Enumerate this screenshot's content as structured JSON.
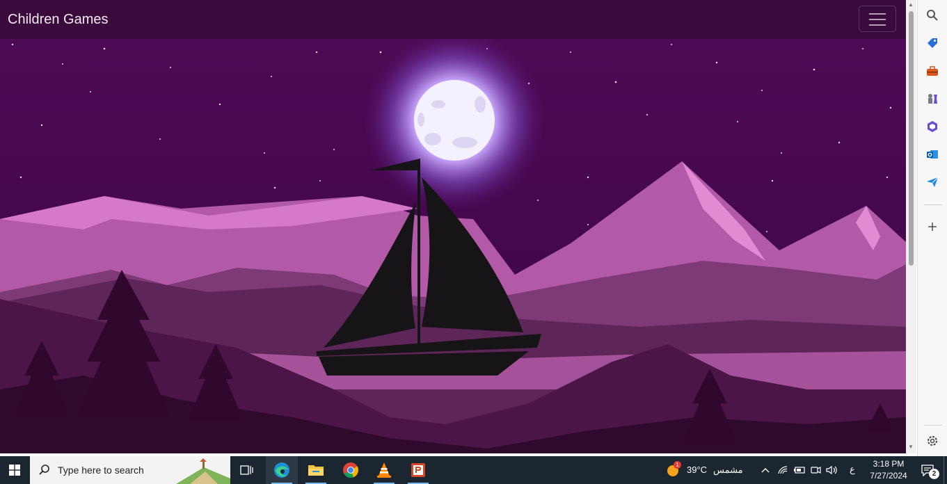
{
  "page": {
    "brand": "Children Games"
  },
  "taskbar": {
    "search_placeholder": "Type here to search",
    "weather_temp": "39°C",
    "weather_text": "مشمس",
    "weather_badge": "1",
    "language": "ع",
    "time": "3:18 PM",
    "date": "7/27/2024",
    "notification_count": "2"
  },
  "colors": {
    "navbar": "#3b0a3c",
    "sky": "#4a0a4e",
    "mountain_pink": "#c765b8",
    "taskbar": "#1b2630"
  }
}
